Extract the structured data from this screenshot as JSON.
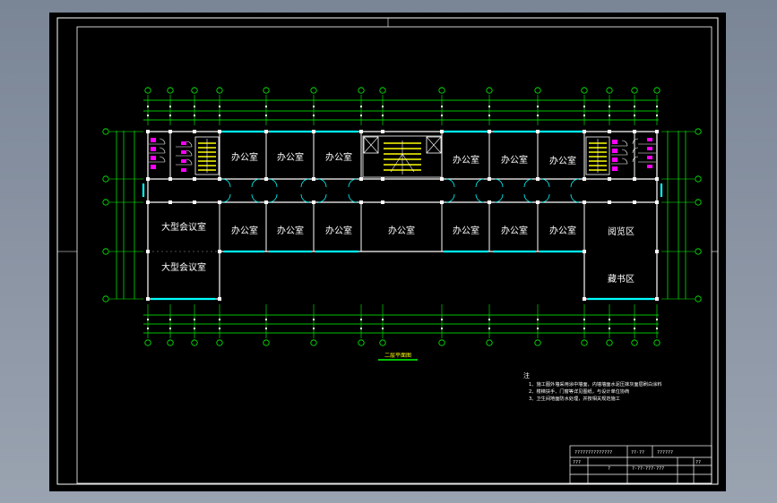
{
  "rooms": {
    "office": "办公室",
    "large_meeting": "大型会议室",
    "reading": "阅览区",
    "library": "藏书区"
  },
  "plan_title": "二层平面图",
  "notes": {
    "heading": "注",
    "line1": "1、施工图外墙采用涂中墙面，内墙墙面水泥压抹灰面层刷白涂料",
    "line2": "2、楼梯扶手、门窗等详见图纸，与设计单位协商",
    "line3": "3、卫生间地面防水处理，并按相关规范施工"
  },
  "title_block": {
    "drawing_no": "??????????????",
    "col_a": "??·??",
    "col_b": "??????",
    "row_a": "???",
    "row_b": "?",
    "row_c": "??",
    "row_d": "?·??·???·???"
  },
  "colors": {
    "wall": "#ffffff",
    "dimension": "#00ff00",
    "window": "#00ffff",
    "stair": "#ffff00",
    "fixture": "#ff00ff",
    "frame": "#ffffff",
    "background": "#000000"
  }
}
